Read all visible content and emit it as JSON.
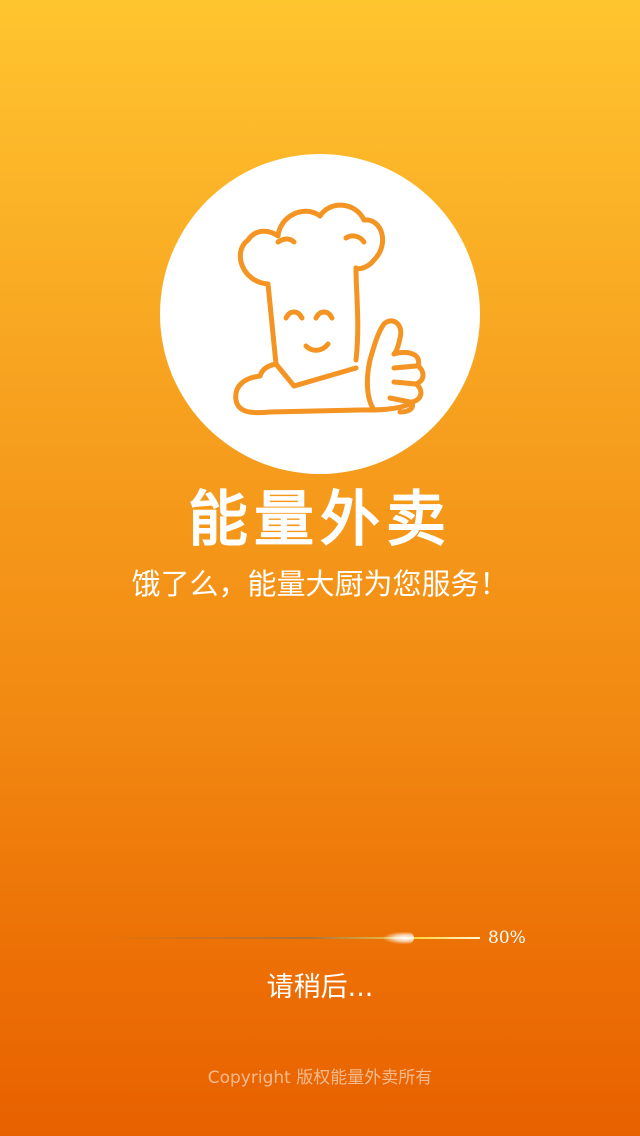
{
  "splash": {
    "logo_icon": "chef-thumbs-up-icon",
    "app_name": "能量外卖",
    "slogan": "饿了么，能量大厨为您服务！"
  },
  "loading": {
    "progress_label": "80%",
    "progress_value": 0.8,
    "message": "请稍后..."
  },
  "footer": {
    "copyright": "Copyright  版权能量外卖所有"
  },
  "colors": {
    "background_top": "#ffc52f",
    "background_bottom": "#e86100",
    "accent": "#f39423",
    "text": "#ffffff"
  }
}
